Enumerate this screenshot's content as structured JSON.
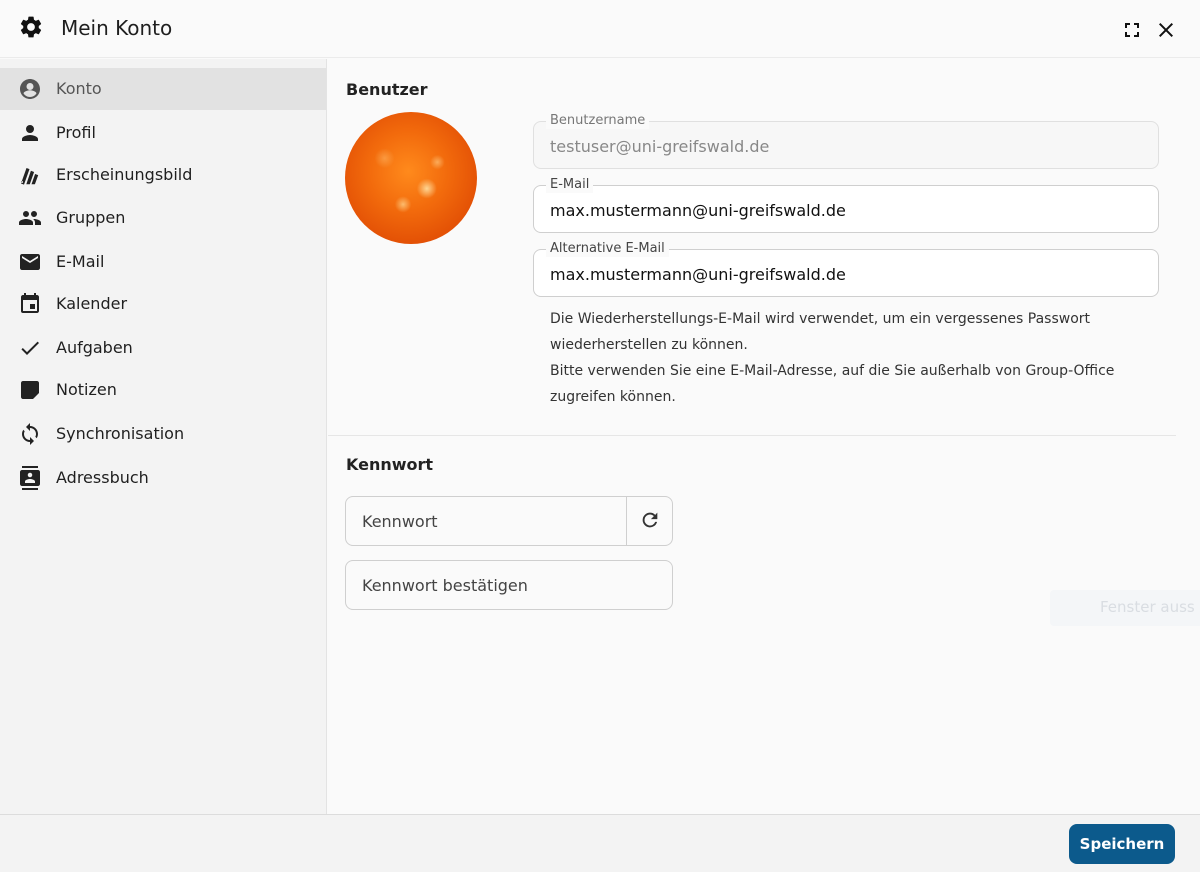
{
  "header": {
    "title": "Mein Konto",
    "icon": "gear-icon",
    "maximize_icon": "fullscreen-icon",
    "close_icon": "close-icon"
  },
  "sidebar": {
    "items": [
      {
        "label": "Konto",
        "icon": "account-circle-icon",
        "active": true
      },
      {
        "label": "Profil",
        "icon": "person-icon"
      },
      {
        "label": "Erscheinungsbild",
        "icon": "palette-swatch-icon"
      },
      {
        "label": "Gruppen",
        "icon": "group-icon"
      },
      {
        "label": "E-Mail",
        "icon": "mail-icon"
      },
      {
        "label": "Kalender",
        "icon": "calendar-icon"
      },
      {
        "label": "Aufgaben",
        "icon": "check-icon"
      },
      {
        "label": "Notizen",
        "icon": "note-icon"
      },
      {
        "label": "Synchronisation",
        "icon": "sync-icon"
      },
      {
        "label": "Adressbuch",
        "icon": "contacts-icon"
      }
    ]
  },
  "user_section": {
    "title": "Benutzer",
    "username": {
      "label": "Benutzername",
      "value": "testuser@uni-greifswald.de"
    },
    "email": {
      "label": "E-Mail",
      "value": "max.mustermann@uni-greifswald.de"
    },
    "alt_email": {
      "label": "Alternative E-Mail",
      "value": "max.mustermann@uni-greifswald.de"
    },
    "hint_1": "Die Wiederherstellungs-E-Mail wird verwendet, um ein vergessenes Passwort wiederherstellen zu können.",
    "hint_2": "Bitte verwenden Sie eine E-Mail-Adresse, auf die Sie außerhalb von Group-Office zugreifen können."
  },
  "password_section": {
    "title": "Kennwort",
    "password_placeholder": "Kennwort",
    "confirm_placeholder": "Kennwort bestätigen"
  },
  "ghost_tooltip": "Fenster auss",
  "footer": {
    "save_label": "Speichern"
  },
  "colors": {
    "accent": "#0c5a8c",
    "sidebar_active": "#e2e2e2"
  }
}
